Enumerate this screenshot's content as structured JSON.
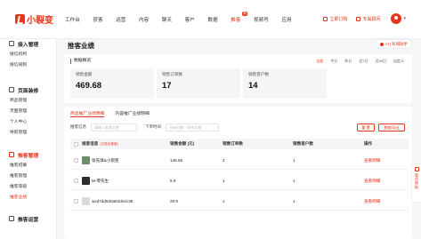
{
  "app": {
    "logo_text": "小裂变"
  },
  "nav": {
    "items": [
      "工作台",
      "获客",
      "运营",
      "内容",
      "聊天",
      "客户",
      "数据",
      "推客",
      "视频号",
      "应用"
    ],
    "active_index": 7,
    "hot_badge": "新",
    "hot_index": 7,
    "order_label": "立即订购",
    "help_label": "专属顾问"
  },
  "sidebar": {
    "groups": [
      {
        "title": "接入管理",
        "icon": "grid-icon",
        "items": [
          "接信机构",
          "接信规则"
        ]
      },
      {
        "title": "页面装修",
        "icon": "layout-icon",
        "items": [
          "商品管理",
          "页面管理",
          "个人中心",
          "导航管理"
        ]
      },
      {
        "title": "推客管理",
        "icon": "users-icon",
        "items": [
          "推客招募",
          "推客管理",
          "推客等级",
          "推客业绩"
        ],
        "active": true,
        "active_item": 3
      },
      {
        "title": "推客运营",
        "icon": "user-icon",
        "items": []
      }
    ]
  },
  "page": {
    "title": "推客业绩",
    "ai_button": "AI | 私域助手"
  },
  "overview": {
    "title": "数据概览",
    "ranges": [
      "全部",
      "今日",
      "昨日",
      "近7日",
      "近30日",
      "自定义"
    ],
    "active_range": 0,
    "stats": [
      {
        "label": "销售金额",
        "value": "469.68"
      },
      {
        "label": "销售订单数",
        "value": "17"
      },
      {
        "label": "销售客户数",
        "value": "14"
      }
    ]
  },
  "table": {
    "tabs": [
      "商品推广业绩明细",
      "内容推广业绩明细"
    ],
    "active_tab": 0,
    "filter": {
      "search_label": "推客信息",
      "search_placeholder": "请输入推客信息",
      "time_label": "下单时间",
      "date_placeholder": "开始日期 ~ 结束日期",
      "reset_label": "重 置",
      "export_label": "数据导出"
    },
    "columns": {
      "name": "推客信息",
      "name_sub": "(已退出推客)",
      "sales": "销售金额 (元)",
      "orders": "销售订单数",
      "customers": "销售客户数",
      "action": "操作"
    },
    "rows": [
      {
        "name": "张先锋&小裂变",
        "sales": "145.58",
        "orders": "2",
        "customers": "1",
        "action": "查看明细",
        "avatar_color": "#6b8b6a"
      },
      {
        "name": "M-零先生",
        "sales": "9.9",
        "orders": "1",
        "customers": "1",
        "action": "查看明细",
        "avatar_color": "#2c2c2c"
      },
      {
        "name": "wxd7dd530a82de4c38",
        "sales": "29.9",
        "orders": "1",
        "customers": "1",
        "action": "查看明细",
        "avatar_color": "#d8dadf"
      }
    ]
  },
  "float": {
    "label": "使用帮助"
  },
  "colors": {
    "accent": "#e8341c"
  }
}
